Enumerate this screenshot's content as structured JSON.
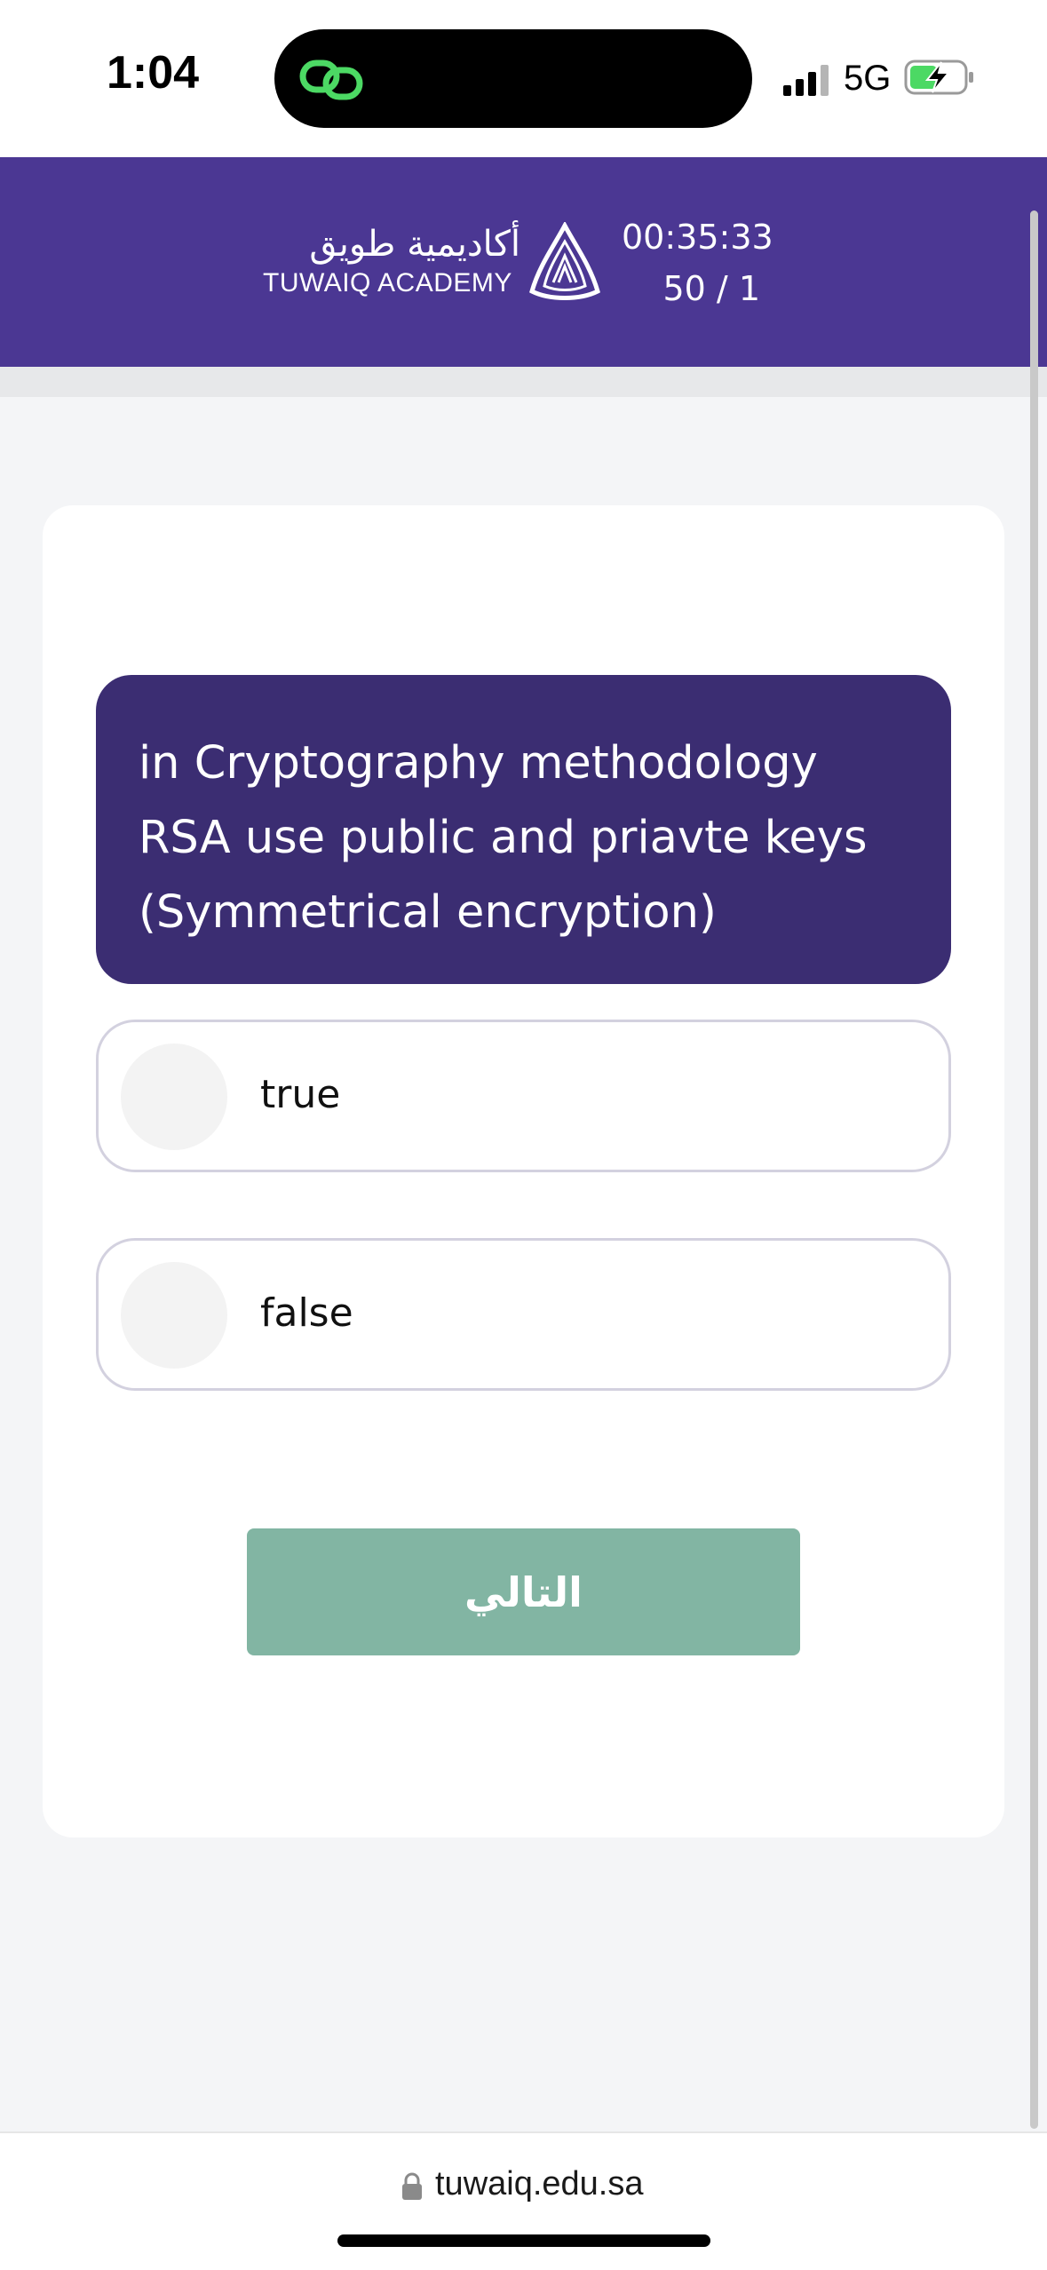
{
  "status_bar": {
    "time": "1:04",
    "network": "5G",
    "icons": [
      "island-app-icon",
      "signal-icon",
      "battery-charging-icon"
    ]
  },
  "header": {
    "logo_arabic": "أكاديمية طويق",
    "logo_english": "TUWAIQ ACADEMY",
    "timer": "00:35:33",
    "question_counter": "50 / 1",
    "colors": {
      "background": "#4b3793"
    }
  },
  "question": {
    "text": "in Cryptography methodology RSA use public and priavte keys (Symmetrical encryption)",
    "colors": {
      "background": "#3b2d72"
    }
  },
  "answers": [
    {
      "label": "true"
    },
    {
      "label": "false"
    }
  ],
  "next_button": {
    "label": "التالي",
    "color": "#82b5a3"
  },
  "browser": {
    "url": "tuwaiq.edu.sa"
  }
}
